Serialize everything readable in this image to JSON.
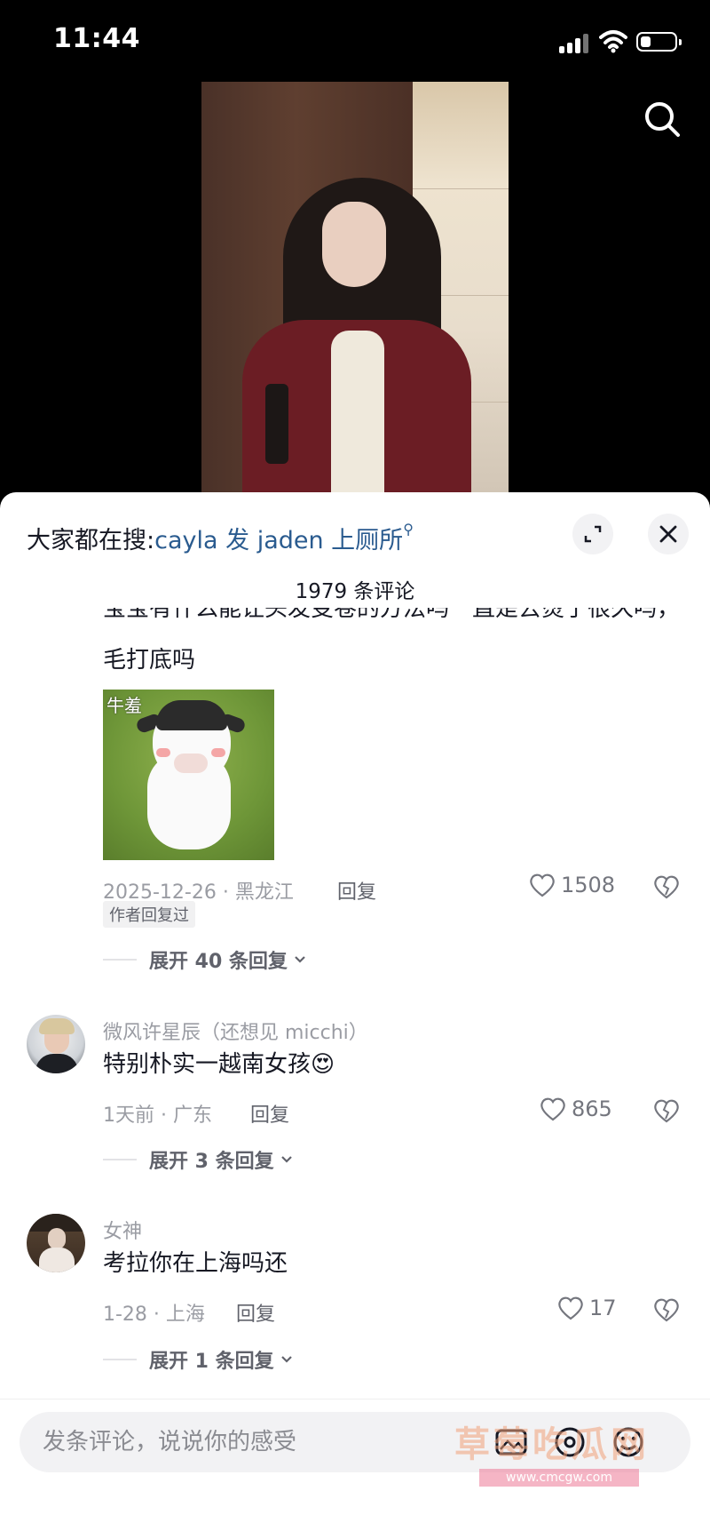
{
  "status_bar": {
    "time": "11:44",
    "battery_level": 0.3
  },
  "hot_search": {
    "label": "大家都在搜:",
    "keyword": "cayla 发 jaden 上厕所"
  },
  "comments_header": {
    "count_text": "1979 条评论"
  },
  "comments": [
    {
      "text_partial": "宝宝有什么能让头发变卷的方法吗一直是去烫了很久吗，需要",
      "text_cont": "毛打底吗",
      "sticker_text": "牛羞",
      "meta": "2025-12-26 · 黑龙江",
      "reply_label": "回复",
      "likes": "1508",
      "badge": "作者回复过",
      "expand_label": "展开 40 条回复"
    },
    {
      "username": "微风许星辰（还想见 micchi）",
      "text": "特别朴实一越南女孩",
      "emoji": "😍",
      "meta": "1天前 · 广东",
      "reply_label": "回复",
      "likes": "865",
      "expand_label": "展开 3 条回复"
    },
    {
      "username": "女神",
      "text": "考拉你在上海吗还",
      "meta": "1-28 · 上海",
      "reply_label": "回复",
      "likes": "17",
      "expand_label": "展开 1 条回复"
    }
  ],
  "input": {
    "placeholder": "发条评论，说说你的感受"
  },
  "watermark": {
    "text": "草莓吃瓜网",
    "url": "www.cmcgw.com"
  },
  "colors": {
    "keyword": "#2a5b8f",
    "sheet_bg": "#ffffff",
    "meta": "#9a9ca3"
  }
}
